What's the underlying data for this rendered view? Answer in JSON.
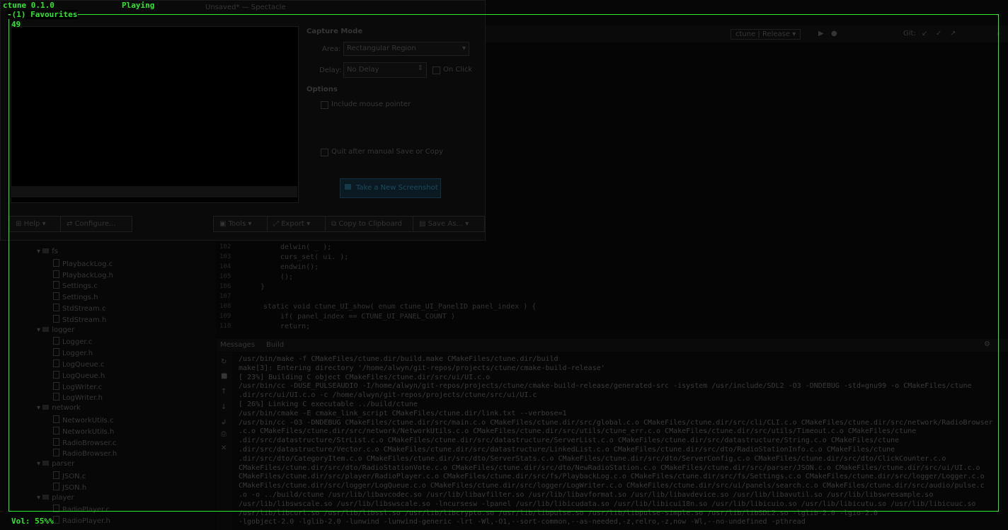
{
  "tui": {
    "app_title": "ctune 0.1.0",
    "status": "Playing",
    "panel_title": "(1) Favourites",
    "count": "49",
    "volume": "Vol: 55%%"
  },
  "spectacle": {
    "window_title": "Unsaved* — Spectacle",
    "capture_mode_label": "Capture Mode",
    "area_label": "Area:",
    "area_value": "Rectangular Region",
    "delay_label": "Delay:",
    "delay_value": "No Delay",
    "on_click_label": "On Click",
    "options_label": "Options",
    "opt_mouse": "Include mouse pointer",
    "opt_quit": "Quit after manual Save or Copy",
    "new_screenshot_btn": "Take a New Screenshot",
    "help_btn": "Help",
    "configure_btn": "Configure...",
    "tools_btn": "Tools",
    "export_btn": "Export",
    "copy_btn": "Copy to Clipboard",
    "save_btn": "Save As..."
  },
  "ide": {
    "run_config": "ctune | Release",
    "git_label": "Git:",
    "tab_messages": "Messages",
    "tab_build": "Build",
    "code_lines": [
      {
        "n": "102",
        "text": "delwin( _ );"
      },
      {
        "n": "103",
        "text": "curs_set( ui. );"
      },
      {
        "n": "104",
        "text": "endwin();"
      },
      {
        "n": "105",
        "text": "();"
      },
      {
        "n": "106",
        "text": "}"
      },
      {
        "n": "107",
        "text": ""
      },
      {
        "n": "108",
        "text": "static void ctune_UI_show( enum ctune_UI_PanelID panel_index ) {"
      },
      {
        "n": "109",
        "text": "if( panel_index == CTUNE_UI_PANEL_COUNT )"
      },
      {
        "n": "110",
        "text": "return;"
      }
    ],
    "tree": [
      {
        "type": "folder",
        "label": "fs",
        "indent": 0
      },
      {
        "type": "file",
        "label": "PlaybackLog.c",
        "indent": 1
      },
      {
        "type": "file",
        "label": "PlaybackLog.h",
        "indent": 1
      },
      {
        "type": "file",
        "label": "Settings.c",
        "indent": 1
      },
      {
        "type": "file",
        "label": "Settings.h",
        "indent": 1
      },
      {
        "type": "file",
        "label": "StdStream.c",
        "indent": 1
      },
      {
        "type": "file",
        "label": "StdStream.h",
        "indent": 1
      },
      {
        "type": "folder",
        "label": "logger",
        "indent": 0
      },
      {
        "type": "file",
        "label": "Logger.c",
        "indent": 1
      },
      {
        "type": "file",
        "label": "Logger.h",
        "indent": 1
      },
      {
        "type": "file",
        "label": "LogQueue.c",
        "indent": 1
      },
      {
        "type": "file",
        "label": "LogQueue.h",
        "indent": 1
      },
      {
        "type": "file",
        "label": "LogWriter.c",
        "indent": 1
      },
      {
        "type": "file",
        "label": "LogWriter.h",
        "indent": 1
      },
      {
        "type": "folder",
        "label": "network",
        "indent": 0
      },
      {
        "type": "file",
        "label": "NetworkUtils.c",
        "indent": 1
      },
      {
        "type": "file",
        "label": "NetworkUtils.h",
        "indent": 1
      },
      {
        "type": "file",
        "label": "RadioBrowser.c",
        "indent": 1
      },
      {
        "type": "file",
        "label": "RadioBrowser.h",
        "indent": 1
      },
      {
        "type": "folder",
        "label": "parser",
        "indent": 0
      },
      {
        "type": "file",
        "label": "JSON.c",
        "indent": 1
      },
      {
        "type": "file",
        "label": "JSON.h",
        "indent": 1
      },
      {
        "type": "folder",
        "label": "player",
        "indent": 0
      },
      {
        "type": "file",
        "label": "RadioPlayer.c",
        "indent": 1
      },
      {
        "type": "file",
        "label": "RadioPlayer.h",
        "indent": 1
      }
    ],
    "build_lines": [
      "/usr/bin/make  -f CMakeFiles/ctune.dir/build.make CMakeFiles/ctune.dir/build",
      "make[3]: Entering directory '/home/alwyn/git-repos/projects/ctune/cmake-build-release'",
      "[ 23%] Building C object CMakeFiles/ctune.dir/src/ui/UI.c.o",
      "/usr/bin/cc -DUSE_PULSEAUDIO -I/home/alwyn/git-repos/projects/ctune/cmake-build-release/generated-src -isystem /usr/include/SDL2 -O3 -DNDEBUG -std=gnu99 -o CMakeFiles/ctune",
      " .dir/src/ui/UI.c.o -c /home/alwyn/git-repos/projects/ctune/src/ui/UI.c",
      "[ 26%] Linking C executable ../build/ctune",
      "/usr/bin/cmake -E cmake_link_script CMakeFiles/ctune.dir/link.txt --verbose=1",
      "/usr/bin/cc -O3 -DNDEBUG CMakeFiles/ctune.dir/src/main.c.o CMakeFiles/ctune.dir/src/global.c.o CMakeFiles/ctune.dir/src/cli/CLI.c.o CMakeFiles/ctune.dir/src/network/RadioBrowser",
      " .c.o CMakeFiles/ctune.dir/src/network/NetworkUtils.c.o CMakeFiles/ctune.dir/src/utils/ctune_err.c.o CMakeFiles/ctune.dir/src/utils/Timeout.c.o CMakeFiles/ctune",
      " .dir/src/datastructure/StrList.c.o CMakeFiles/ctune.dir/src/datastructure/ServerList.c.o CMakeFiles/ctune.dir/src/datastructure/String.c.o CMakeFiles/ctune",
      " .dir/src/datastructure/Vector.c.o CMakeFiles/ctune.dir/src/datastructure/LinkedList.c.o CMakeFiles/ctune.dir/src/dto/RadioStationInfo.c.o CMakeFiles/ctune",
      " .dir/src/dto/CategoryItem.c.o CMakeFiles/ctune.dir/src/dto/ServerStats.c.o CMakeFiles/ctune.dir/src/dto/ServerConfig.c.o CMakeFiles/ctune.dir/src/dto/ClickCounter.c.o",
      " CMakeFiles/ctune.dir/src/dto/RadioStationVote.c.o CMakeFiles/ctune.dir/src/dto/NewRadioStation.c.o CMakeFiles/ctune.dir/src/parser/JSON.c.o CMakeFiles/ctune.dir/src/ui/UI.c.o",
      " CMakeFiles/ctune.dir/src/player/RadioPlayer.c.o CMakeFiles/ctune.dir/src/fs/PlaybackLog.c.o CMakeFiles/ctune.dir/src/fs/Settings.c.o CMakeFiles/ctune.dir/src/logger/Logger.c.o",
      " CMakeFiles/ctune.dir/src/logger/LogQueue.c.o CMakeFiles/ctune.dir/src/logger/LogWriter.c.o CMakeFiles/ctune.dir/src/ui/panels/search.c.o CMakeFiles/ctune.dir/src/audio/pulse.c",
      " .o -o ../build/ctune  /usr/lib/libavcodec.so /usr/lib/libavfilter.so /usr/lib/libavformat.so /usr/lib/libavdevice.so /usr/lib/libavutil.so /usr/lib/libswresample.so",
      " /usr/lib/libswscale.so /usr/lib/libswscale.so -lncursesw -lpanel /usr/lib/libicudata.so /usr/lib/libicui18n.so /usr/lib/libicuio.so /usr/lib/libicutu.so /usr/lib/libicuuc.so",
      " /usr/lib/libcurl.so /usr/lib/libssl.so /usr/lib/libcrypto.so /usr/lib/libpulse.so /usr/lib/libpulse-simple.so /usr/lib/libSDL2.so -lglib-2.0 -lgio-2.0",
      " -lgobject-2.0 -lglib-2.0 -lunwind -lunwind-generic -lrt -Wl,-O1,--sort-common,--as-needed,-z,relro,-z,now -Wl,--no-undefined -pthread"
    ]
  }
}
